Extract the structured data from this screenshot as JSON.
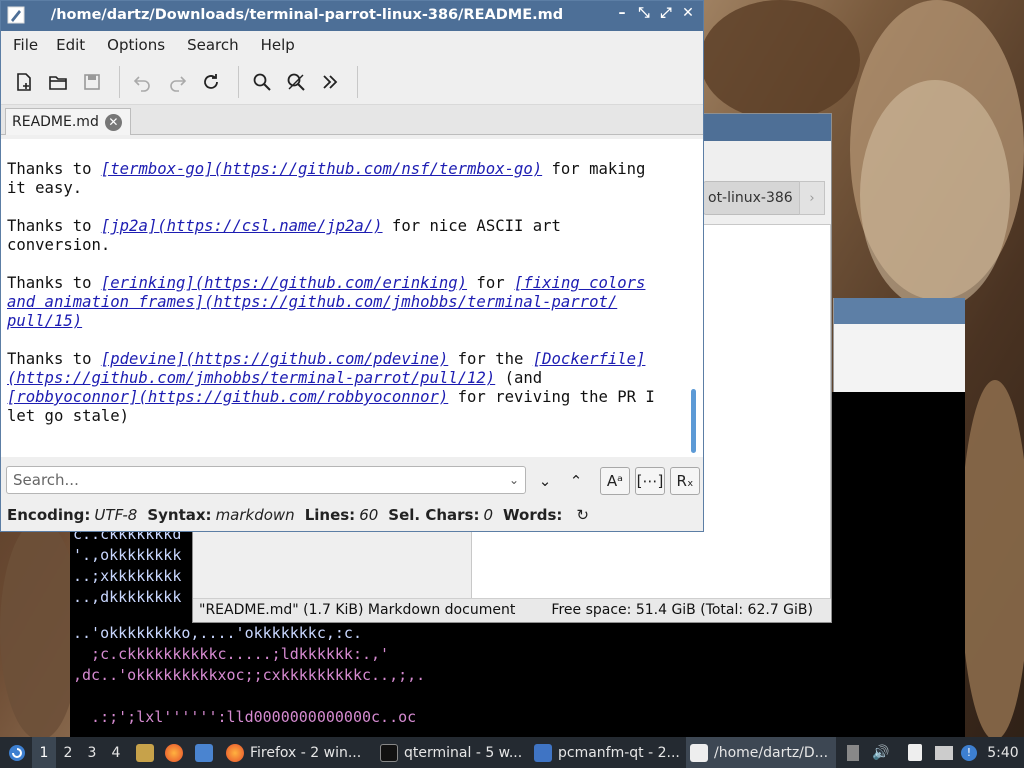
{
  "editor": {
    "title": "/home/dartz/Downloads/terminal-parrot-linux-386/README.md",
    "menu": [
      "File",
      "Edit",
      "Options",
      "Search",
      "Help"
    ],
    "tab_label": "README.md",
    "doc": {
      "l1a": "Thanks to ",
      "l1b": "[termbox-go](https://github.com/nsf/termbox-go)",
      "l1c": " for making",
      "l2": "it easy.",
      "l3a": "Thanks to ",
      "l3b": "[jp2a](https://csl.name/jp2a/)",
      "l3c": " for nice ASCII art",
      "l4": "conversion.",
      "l5a": "Thanks to ",
      "l5b": "[erinking](https://github.com/erinking)",
      "l5c": " for ",
      "l5d": "[fixing colors",
      "l6": "and animation frames](https://github.com/jmhobbs/terminal-parrot/",
      "l7": "pull/15)",
      "l8a": "Thanks to ",
      "l8b": "[pdevine](https://github.com/pdevine)",
      "l8c": " for the ",
      "l8d": "[Dockerfile]",
      "l9a": "(https://github.com/jmhobbs/terminal-parrot/pull/12)",
      "l9b": " (and",
      "l10a": "[robbyoconnor](https://github.com/robbyoconnor)",
      "l10b": " for reviving the PR I",
      "l11": "let go stale)"
    },
    "search_placeholder": "Search...",
    "status": {
      "encoding_label": "Encoding:",
      "encoding": "UTF-8",
      "syntax_label": "Syntax:",
      "syntax": "markdown",
      "lines_label": "Lines:",
      "lines": "60",
      "selchars_label": "Sel. Chars:",
      "selchars": "0",
      "words_label": "Words:"
    },
    "colors": {
      "titlebar": "#4d6f97",
      "link": "#1d1db2"
    }
  },
  "file_manager": {
    "path_fragment": "ot-linux-386",
    "status_left": "\"README.md\" (1.7 KiB) Markdown document",
    "status_right": "Free space: 51.4 GiB (Total: 62.7 GiB)"
  },
  "terminal": {
    "lines": [
      "c..ckkkkkkkd",
      "'.,okkkkkkkk",
      "..;xkkkkkkkk",
      "..,dkkkkkkkk",
      "..'okkkkkkkko,....'okkkkkkkc,:c.",
      "  ;c.ckkkkkkkkkkc.....;ldkkkkkk:.,'",
      ",dc..'okkkkkkkkkxoc;;cxkkkkkkkkkc..,;,.",
      "  .:;';lxl'''''':lld0000000000000c..oc"
    ]
  },
  "taskbar": {
    "desktops": [
      "1",
      "2",
      "3",
      "4"
    ],
    "tasks": [
      {
        "label": "Firefox - 2 win..."
      },
      {
        "label": "qterminal - 5 w..."
      },
      {
        "label": "pcmanfm-qt - 2..."
      },
      {
        "label": "/home/dartz/D..."
      }
    ],
    "clock": "5:40"
  }
}
